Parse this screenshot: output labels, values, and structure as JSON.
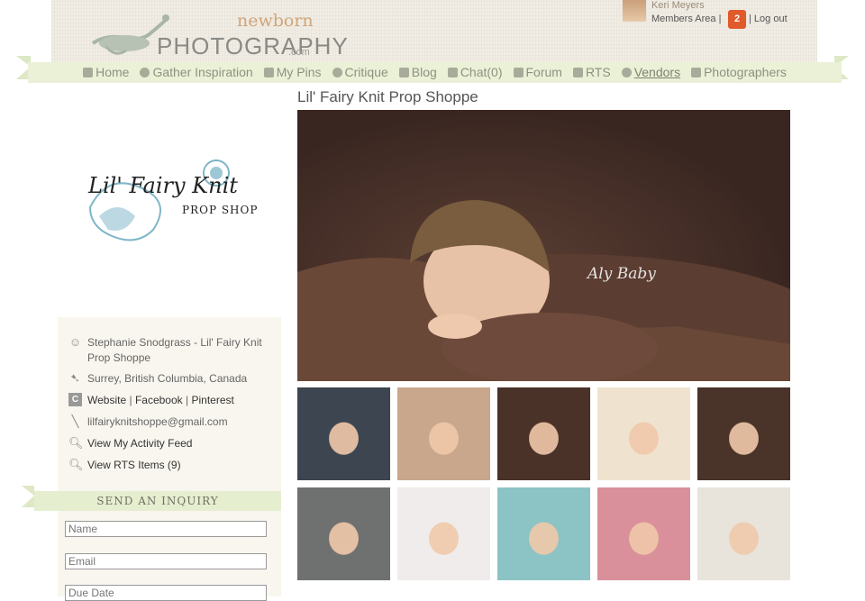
{
  "brand": {
    "newborn": "newborn",
    "photography": "PHOTOGRAPHY",
    "com": ".com"
  },
  "user": {
    "name": "Keri Meyers",
    "members_area": "Members Area",
    "notifications": "2",
    "logout": "Log out",
    "sep": "|"
  },
  "nav": [
    {
      "label": "Home",
      "icon": "home-icon"
    },
    {
      "label": "Gather Inspiration",
      "icon": "bulb-icon"
    },
    {
      "label": "My Pins",
      "icon": "pin-icon"
    },
    {
      "label": "Critique",
      "icon": "heart-icon"
    },
    {
      "label": "Blog",
      "icon": "star-icon"
    },
    {
      "label": "Chat(0)",
      "icon": "chat-icon"
    },
    {
      "label": "Forum",
      "icon": "forum-icon"
    },
    {
      "label": "RTS",
      "icon": "tag-icon"
    },
    {
      "label": "Vendors",
      "icon": "vendor-icon",
      "active": true
    },
    {
      "label": "Photographers",
      "icon": "camera-icon"
    }
  ],
  "vendor": {
    "title": "Lil' Fairy Knit Prop Shoppe",
    "logo_line1": "Lil' Fairy Knit",
    "logo_line2": "PROP SHOP",
    "owner": "Stephanie Snodgrass - Lil' Fairy Knit Prop Shoppe",
    "location": "Surrey, British Columbia, Canada",
    "links": {
      "website": "Website",
      "facebook": "Facebook",
      "pinterest": "Pinterest",
      "sep": "|"
    },
    "email": "lilfairyknitshoppe@gmail.com",
    "activity": "View My Activity Feed",
    "rts": "View RTS Items (9)"
  },
  "hero_watermark": "Aly Baby",
  "inquiry": {
    "title": "SEND AN INQUIRY",
    "name_placeholder": "Name",
    "email_placeholder": "Email",
    "date_placeholder": "Due Date"
  },
  "thumbs": [
    {
      "bg": "#3d4550"
    },
    {
      "bg": "#c8a78c"
    },
    {
      "bg": "#4a3228"
    },
    {
      "bg": "#efe3cf"
    },
    {
      "bg": "#4a3329"
    },
    {
      "bg": "#6f7170"
    },
    {
      "bg": "#efeceb"
    },
    {
      "bg": "#8cc3c4"
    },
    {
      "bg": "#d9909a"
    },
    {
      "bg": "#e8e4dc"
    }
  ]
}
